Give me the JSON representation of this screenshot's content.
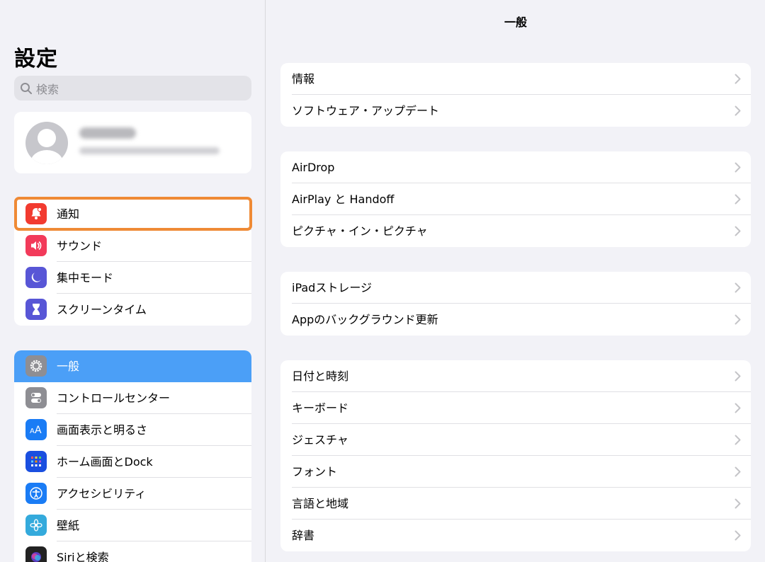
{
  "sidebar": {
    "title": "設定",
    "search_placeholder": "検索",
    "group1": [
      {
        "label": "通知",
        "icon": "notification-bell-icon",
        "color": "#f23b30"
      },
      {
        "label": "サウンド",
        "icon": "speaker-icon",
        "color": "#f23a5a"
      },
      {
        "label": "集中モード",
        "icon": "moon-icon",
        "color": "#5856d6"
      },
      {
        "label": "スクリーンタイム",
        "icon": "hourglass-icon",
        "color": "#5856d6"
      }
    ],
    "group2": [
      {
        "label": "一般",
        "icon": "gear-icon",
        "color": "#8e8e93",
        "selected": true
      },
      {
        "label": "コントロールセンター",
        "icon": "toggles-icon",
        "color": "#8e8e93"
      },
      {
        "label": "画面表示と明るさ",
        "icon": "text-size-icon",
        "color": "#1a7cf5"
      },
      {
        "label": "ホーム画面とDock",
        "icon": "app-grid-icon",
        "color": "#1a4fe0"
      },
      {
        "label": "アクセシビリティ",
        "icon": "accessibility-icon",
        "color": "#1a7cf5"
      },
      {
        "label": "壁紙",
        "icon": "flower-icon",
        "color": "#34aadc"
      },
      {
        "label": "Siriと検索",
        "icon": "siri-icon",
        "color": "#222222"
      }
    ]
  },
  "detail": {
    "title": "一般",
    "groups": [
      [
        "情報",
        "ソフトウェア・アップデート"
      ],
      [
        "AirDrop",
        "AirPlay と Handoff",
        "ピクチャ・イン・ピクチャ"
      ],
      [
        "iPadストレージ",
        "Appのバックグラウンド更新"
      ],
      [
        "日付と時刻",
        "キーボード",
        "ジェスチャ",
        "フォント",
        "言語と地域",
        "辞書"
      ]
    ]
  },
  "colors": {
    "accent": "#4b9ff7",
    "highlight": "#ef8a35"
  }
}
